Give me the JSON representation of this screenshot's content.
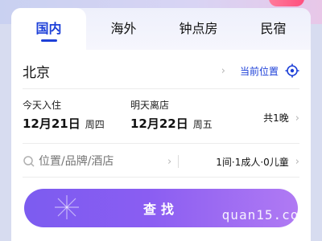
{
  "tabs": [
    {
      "label": "国内",
      "active": true
    },
    {
      "label": "海外",
      "active": false
    },
    {
      "label": "钟点房",
      "active": false
    },
    {
      "label": "民宿",
      "active": false
    }
  ],
  "location": {
    "city": "北京",
    "current_location_label": "当前位置",
    "icon": "locate-icon"
  },
  "checkin": {
    "label": "今天入住",
    "date": "12月21日",
    "weekday": "周四"
  },
  "checkout": {
    "label": "明天离店",
    "date": "12月22日",
    "weekday": "周五"
  },
  "nights": "共1晚",
  "search": {
    "placeholder": "位置/品牌/酒店",
    "icon": "search-icon"
  },
  "guests": "1间·1成人·0儿童",
  "search_button": {
    "label": "查找"
  },
  "watermark": "quan15.com",
  "colors": {
    "accent": "#1d40d8",
    "button_start": "#7c5cf0",
    "button_end": "#b07af3"
  }
}
